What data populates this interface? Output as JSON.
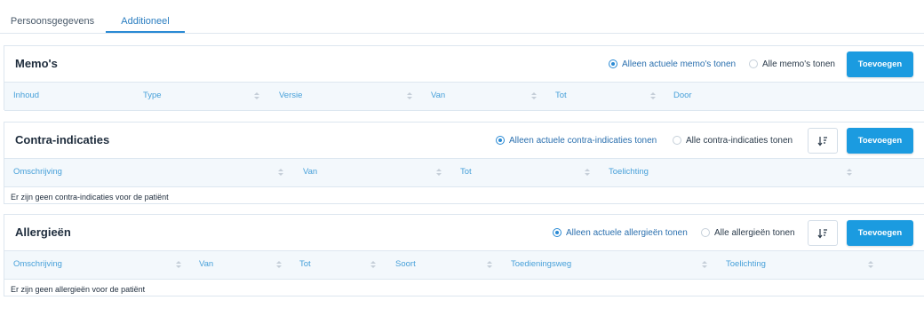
{
  "tabs": [
    "Persoonsgegevens",
    "Additioneel"
  ],
  "memos": {
    "title": "Memo's",
    "radio_current": "Alleen actuele memo's tonen",
    "radio_all": "Alle memo's tonen",
    "add_label": "Toevoegen",
    "columns": [
      "Inhoud",
      "Type",
      "Versie",
      "Van",
      "Tot",
      "Door"
    ]
  },
  "contra": {
    "title": "Contra-indicaties",
    "radio_current": "Alleen actuele contra-indicaties tonen",
    "radio_all": "Alle contra-indicaties tonen",
    "add_label": "Toevoegen",
    "columns": [
      "Omschrijving",
      "Van",
      "Tot",
      "Toelichting"
    ],
    "empty_text": "Er zijn geen contra-indicaties voor de patiënt"
  },
  "allergies": {
    "title": "Allergieën",
    "radio_current": "Alleen actuele allergieën tonen",
    "radio_all": "Alle allergieën tonen",
    "add_label": "Toevoegen",
    "columns": [
      "Omschrijving",
      "Van",
      "Tot",
      "Soort",
      "Toedieningsweg",
      "Toelichting"
    ],
    "empty_text": "Er zijn geen allergieën voor de patiënt"
  },
  "colors": {
    "accent": "#1b9be0",
    "header_text": "#47a0d9",
    "header_bg": "#f3f8fc"
  }
}
